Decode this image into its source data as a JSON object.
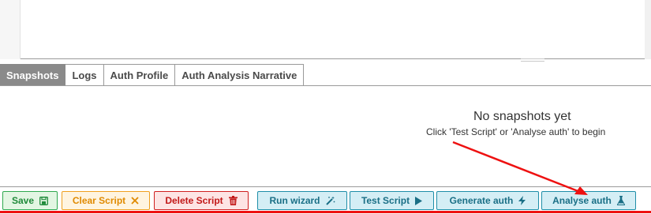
{
  "tabs": [
    {
      "label": "Snapshots",
      "active": true
    },
    {
      "label": "Logs",
      "active": false
    },
    {
      "label": "Auth Profile",
      "active": false
    },
    {
      "label": "Auth Analysis Narrative",
      "active": false
    }
  ],
  "empty_state": {
    "title": "No snapshots yet",
    "subtitle": "Click 'Test Script' or 'Analyse auth' to begin"
  },
  "toolbar": {
    "save": {
      "label": "Save",
      "icon": "floppy-disk-icon"
    },
    "clear_script": {
      "label": "Clear Script",
      "icon": "x-icon"
    },
    "delete_script": {
      "label": "Delete Script",
      "icon": "trash-icon"
    },
    "run_wizard": {
      "label": "Run wizard",
      "icon": "magic-wand-icon"
    },
    "test_script": {
      "label": "Test Script",
      "icon": "play-icon"
    },
    "generate_auth": {
      "label": "Generate auth",
      "icon": "lightning-bolt-icon"
    },
    "analyse_auth": {
      "label": "Analyse auth",
      "icon": "flask-icon"
    }
  },
  "colors": {
    "annotation_red": "#ee1111",
    "active_tab": "#8a8a8a",
    "green": "#2fa84f",
    "orange": "#f0a020",
    "red": "#d02020",
    "teal": "#1f8ea8"
  }
}
